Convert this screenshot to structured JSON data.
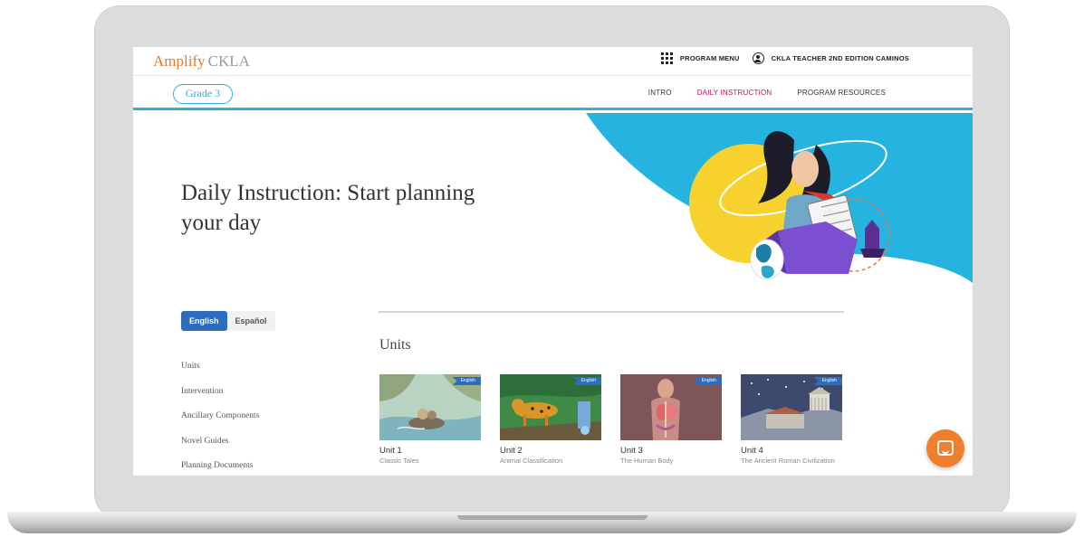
{
  "header": {
    "brand": "Amplify",
    "product": "CKLA",
    "program_menu": "PROGRAM MENU",
    "user_label": "CKLA TEACHER 2ND EDITION CAMINOS"
  },
  "subnav": {
    "grade": "Grade 3",
    "tabs": [
      "INTRO",
      "DAILY INSTRUCTION",
      "PROGRAM RESOURCES"
    ],
    "active_tab": "DAILY INSTRUCTION"
  },
  "hero": {
    "title": "Daily Instruction: Start planning your day"
  },
  "language": {
    "options": [
      "English",
      "Español"
    ],
    "selected": "English"
  },
  "sidebar": {
    "items": [
      "Units",
      "Intervention",
      "Ancillary Components",
      "Novel Guides",
      "Planning Documents"
    ]
  },
  "units_section": {
    "heading": "Units",
    "units": [
      {
        "title": "Unit 1",
        "subtitle": "Classic Tales",
        "badge": "English"
      },
      {
        "title": "Unit 2",
        "subtitle": "Animal Classification",
        "badge": "English"
      },
      {
        "title": "Unit 3",
        "subtitle": "The Human Body",
        "badge": "English"
      },
      {
        "title": "Unit 4",
        "subtitle": "The Ancient Roman Civilization",
        "badge": "English"
      }
    ]
  },
  "colors": {
    "accent_blue": "#2fb1d8",
    "brand_orange": "#e8782b",
    "active_tab": "#c0135f",
    "toggle_blue": "#2c6ebd",
    "chat_orange": "#f07f2d"
  },
  "icons": [
    "program-menu-grid-icon",
    "user-account-icon",
    "chat-icon"
  ]
}
